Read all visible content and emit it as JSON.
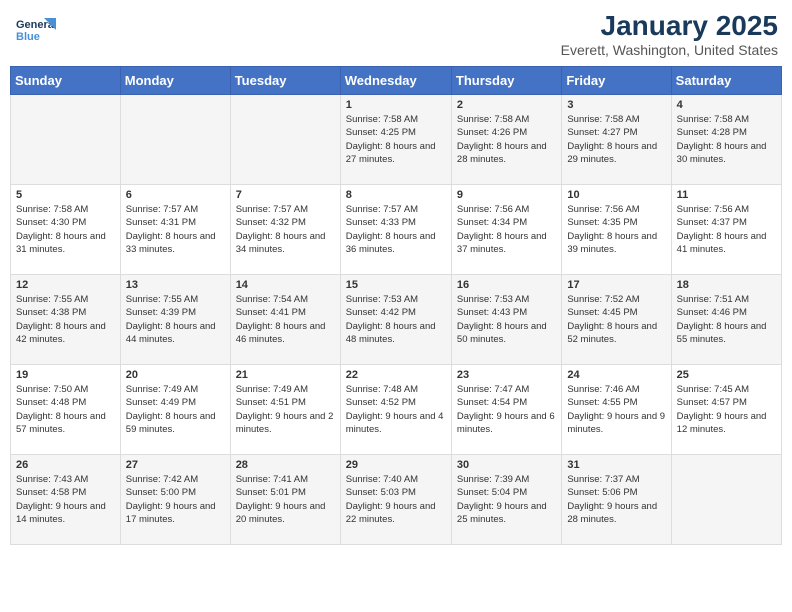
{
  "header": {
    "logo_general": "General",
    "logo_blue": "Blue",
    "month_title": "January 2025",
    "location": "Everett, Washington, United States"
  },
  "days_of_week": [
    "Sunday",
    "Monday",
    "Tuesday",
    "Wednesday",
    "Thursday",
    "Friday",
    "Saturday"
  ],
  "weeks": [
    [
      {
        "day": "",
        "info": ""
      },
      {
        "day": "",
        "info": ""
      },
      {
        "day": "",
        "info": ""
      },
      {
        "day": "1",
        "info": "Sunrise: 7:58 AM\nSunset: 4:25 PM\nDaylight: 8 hours and 27 minutes."
      },
      {
        "day": "2",
        "info": "Sunrise: 7:58 AM\nSunset: 4:26 PM\nDaylight: 8 hours and 28 minutes."
      },
      {
        "day": "3",
        "info": "Sunrise: 7:58 AM\nSunset: 4:27 PM\nDaylight: 8 hours and 29 minutes."
      },
      {
        "day": "4",
        "info": "Sunrise: 7:58 AM\nSunset: 4:28 PM\nDaylight: 8 hours and 30 minutes."
      }
    ],
    [
      {
        "day": "5",
        "info": "Sunrise: 7:58 AM\nSunset: 4:30 PM\nDaylight: 8 hours and 31 minutes."
      },
      {
        "day": "6",
        "info": "Sunrise: 7:57 AM\nSunset: 4:31 PM\nDaylight: 8 hours and 33 minutes."
      },
      {
        "day": "7",
        "info": "Sunrise: 7:57 AM\nSunset: 4:32 PM\nDaylight: 8 hours and 34 minutes."
      },
      {
        "day": "8",
        "info": "Sunrise: 7:57 AM\nSunset: 4:33 PM\nDaylight: 8 hours and 36 minutes."
      },
      {
        "day": "9",
        "info": "Sunrise: 7:56 AM\nSunset: 4:34 PM\nDaylight: 8 hours and 37 minutes."
      },
      {
        "day": "10",
        "info": "Sunrise: 7:56 AM\nSunset: 4:35 PM\nDaylight: 8 hours and 39 minutes."
      },
      {
        "day": "11",
        "info": "Sunrise: 7:56 AM\nSunset: 4:37 PM\nDaylight: 8 hours and 41 minutes."
      }
    ],
    [
      {
        "day": "12",
        "info": "Sunrise: 7:55 AM\nSunset: 4:38 PM\nDaylight: 8 hours and 42 minutes."
      },
      {
        "day": "13",
        "info": "Sunrise: 7:55 AM\nSunset: 4:39 PM\nDaylight: 8 hours and 44 minutes."
      },
      {
        "day": "14",
        "info": "Sunrise: 7:54 AM\nSunset: 4:41 PM\nDaylight: 8 hours and 46 minutes."
      },
      {
        "day": "15",
        "info": "Sunrise: 7:53 AM\nSunset: 4:42 PM\nDaylight: 8 hours and 48 minutes."
      },
      {
        "day": "16",
        "info": "Sunrise: 7:53 AM\nSunset: 4:43 PM\nDaylight: 8 hours and 50 minutes."
      },
      {
        "day": "17",
        "info": "Sunrise: 7:52 AM\nSunset: 4:45 PM\nDaylight: 8 hours and 52 minutes."
      },
      {
        "day": "18",
        "info": "Sunrise: 7:51 AM\nSunset: 4:46 PM\nDaylight: 8 hours and 55 minutes."
      }
    ],
    [
      {
        "day": "19",
        "info": "Sunrise: 7:50 AM\nSunset: 4:48 PM\nDaylight: 8 hours and 57 minutes."
      },
      {
        "day": "20",
        "info": "Sunrise: 7:49 AM\nSunset: 4:49 PM\nDaylight: 8 hours and 59 minutes."
      },
      {
        "day": "21",
        "info": "Sunrise: 7:49 AM\nSunset: 4:51 PM\nDaylight: 9 hours and 2 minutes."
      },
      {
        "day": "22",
        "info": "Sunrise: 7:48 AM\nSunset: 4:52 PM\nDaylight: 9 hours and 4 minutes."
      },
      {
        "day": "23",
        "info": "Sunrise: 7:47 AM\nSunset: 4:54 PM\nDaylight: 9 hours and 6 minutes."
      },
      {
        "day": "24",
        "info": "Sunrise: 7:46 AM\nSunset: 4:55 PM\nDaylight: 9 hours and 9 minutes."
      },
      {
        "day": "25",
        "info": "Sunrise: 7:45 AM\nSunset: 4:57 PM\nDaylight: 9 hours and 12 minutes."
      }
    ],
    [
      {
        "day": "26",
        "info": "Sunrise: 7:43 AM\nSunset: 4:58 PM\nDaylight: 9 hours and 14 minutes."
      },
      {
        "day": "27",
        "info": "Sunrise: 7:42 AM\nSunset: 5:00 PM\nDaylight: 9 hours and 17 minutes."
      },
      {
        "day": "28",
        "info": "Sunrise: 7:41 AM\nSunset: 5:01 PM\nDaylight: 9 hours and 20 minutes."
      },
      {
        "day": "29",
        "info": "Sunrise: 7:40 AM\nSunset: 5:03 PM\nDaylight: 9 hours and 22 minutes."
      },
      {
        "day": "30",
        "info": "Sunrise: 7:39 AM\nSunset: 5:04 PM\nDaylight: 9 hours and 25 minutes."
      },
      {
        "day": "31",
        "info": "Sunrise: 7:37 AM\nSunset: 5:06 PM\nDaylight: 9 hours and 28 minutes."
      },
      {
        "day": "",
        "info": ""
      }
    ]
  ]
}
